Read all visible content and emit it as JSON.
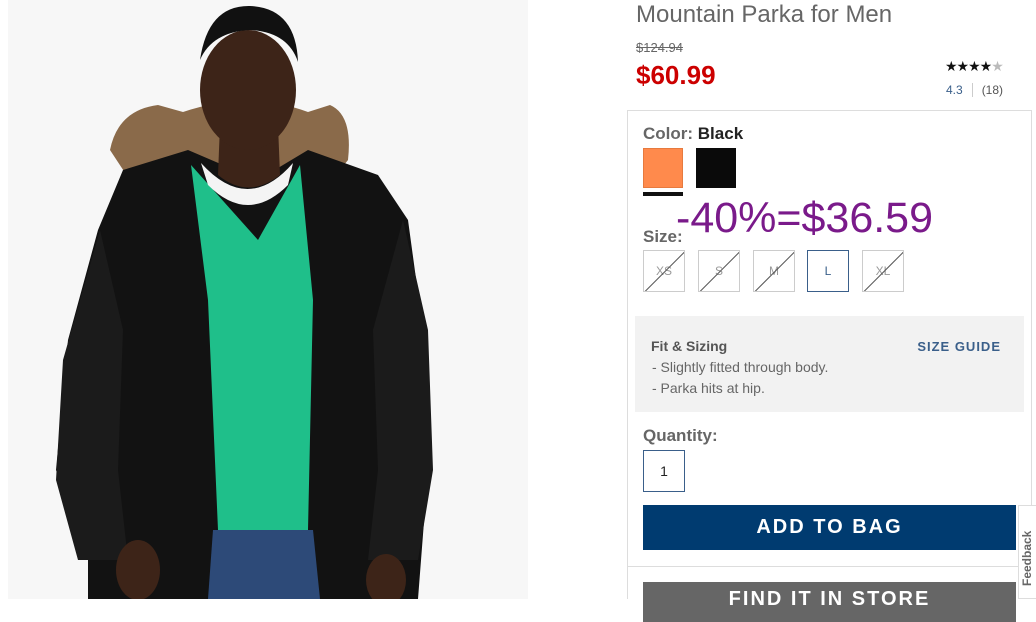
{
  "product": {
    "title": "Mountain Parka for Men",
    "old_price": "$124.94",
    "sale_price": "$60.99",
    "rating": {
      "stars_filled": "★★★★",
      "stars_empty": "★",
      "value": "4.3",
      "count": "(18)"
    },
    "image_icon": "product-photo"
  },
  "color": {
    "label": "Color:",
    "selected": "Black",
    "swatches": [
      {
        "name": "orange",
        "hex": "#ff8a4c"
      },
      {
        "name": "black",
        "hex": "#0a0a0a"
      }
    ]
  },
  "promo_overlay": "-40%=$36.59",
  "size": {
    "label": "Size:",
    "options": [
      "XS",
      "S",
      "M",
      "L",
      "XL"
    ],
    "selected": "L",
    "unavailable": [
      "XS",
      "S",
      "M",
      "XL"
    ]
  },
  "fit": {
    "title": "Fit & Sizing",
    "guide_link": "SIZE GUIDE",
    "lines": [
      "- Slightly fitted through body.",
      "- Parka hits at hip."
    ]
  },
  "quantity": {
    "label": "Quantity:",
    "value": "1"
  },
  "buttons": {
    "add_to_bag": "ADD TO BAG",
    "find_in_store": "FIND IT IN STORE"
  },
  "feedback_tab": "Feedback",
  "colors": {
    "sale_red": "#cc0000",
    "brand_navy": "#003b70",
    "promo_purple": "#7a1a8a",
    "link_blue": "#3a5f8a"
  }
}
